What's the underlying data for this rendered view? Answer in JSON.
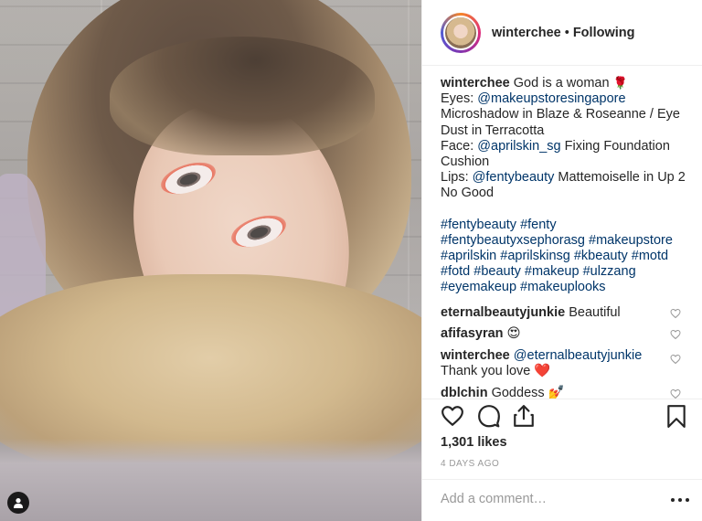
{
  "header": {
    "username": "winterchee",
    "separator": "•",
    "follow_status": "Following"
  },
  "caption": {
    "username": "winterchee",
    "line1_text": "God is a woman",
    "line1_emoji": "🌹",
    "eyes_label": "Eyes:",
    "eyes_mention": "@makeupstoresingapore",
    "eyes_products": "Microshadow in Blaze & Roseanne / Eye Dust in Terracotta",
    "face_label": "Face:",
    "face_mention": "@aprilskin_sg",
    "face_products": "Fixing Foundation Cushion",
    "lips_label": "Lips:",
    "lips_mention": "@fentybeauty",
    "lips_products": "Mattemoiselle in Up 2 No Good",
    "hashtags": "#fentybeauty #fenty #fentybeautyxsephorasg #makeupstore #aprilskin #aprilskinsg #kbeauty #motd #fotd #beauty #makeup #ulzzang #eyemakeup #makeuplooks"
  },
  "comments": [
    {
      "username": "eternalbeautyjunkie",
      "text": "Beautiful",
      "emoji": ""
    },
    {
      "username": "afifasyran",
      "text": "",
      "emoji": "😍"
    },
    {
      "username": "winterchee",
      "mention": "@eternalbeautyjunkie",
      "text": "Thank you love",
      "emoji": "❤️"
    },
    {
      "username": "dblchin",
      "text": "Goddess",
      "emoji": "💅"
    }
  ],
  "likes": "1,301 likes",
  "date": "4 DAYS AGO",
  "add_comment_placeholder": "Add a comment…",
  "icons": {
    "like": "heart-icon",
    "comment": "comment-icon",
    "share": "share-icon",
    "save": "bookmark-icon",
    "more": "more-options-icon",
    "tag": "user-tag-icon"
  },
  "colors": {
    "link": "#003569",
    "text": "#262626",
    "muted": "#999999",
    "border": "#efefef"
  }
}
